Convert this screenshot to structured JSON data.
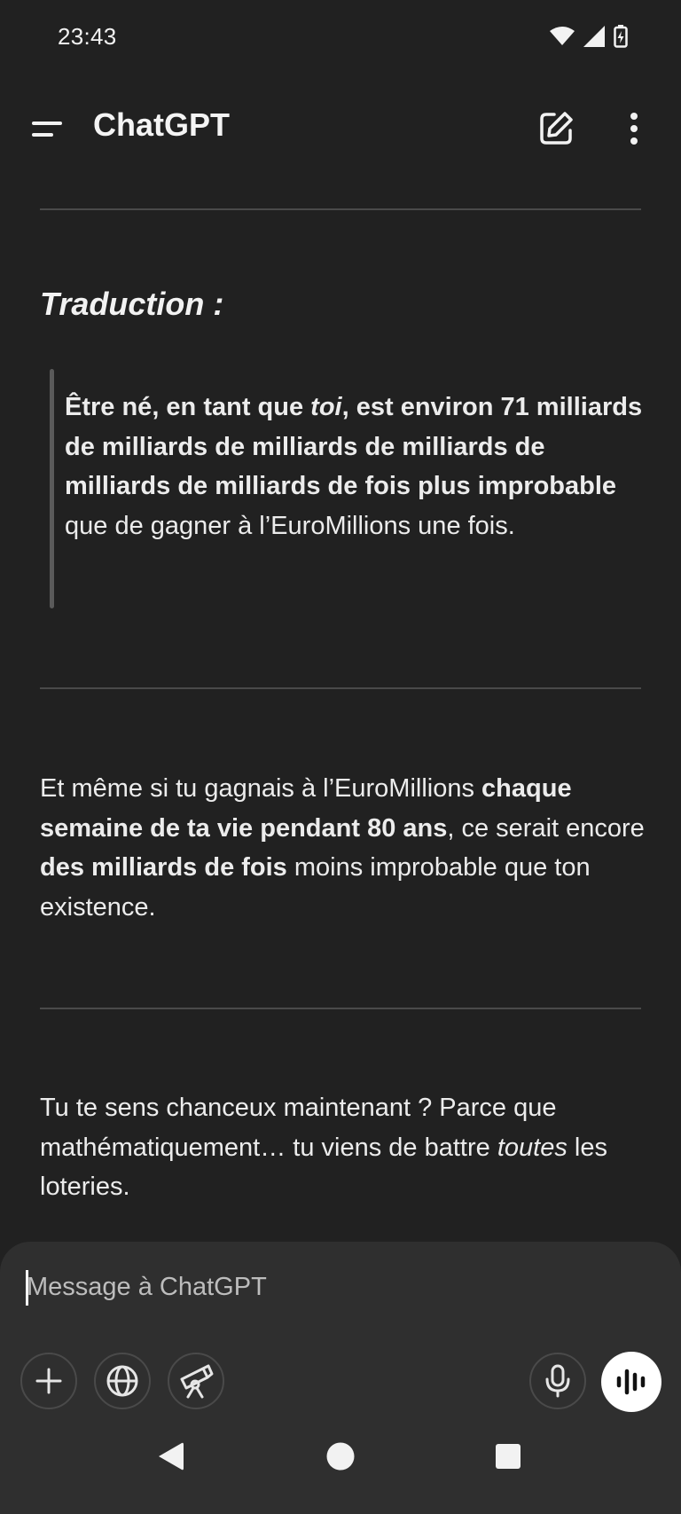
{
  "status_bar": {
    "time": "23:43"
  },
  "header": {
    "title": "ChatGPT"
  },
  "conversation": {
    "heading": "Traduction :",
    "quote": [
      {
        "text": "Être né, en tant que ",
        "style": "bold"
      },
      {
        "text": "toi",
        "style": "bold-italic"
      },
      {
        "text": ", est environ 71 milliards de milliards de milliards de milliards de milliards de milliards de fois plus improbable",
        "style": "bold"
      },
      {
        "text": " que de gagner à l’EuroMillions une fois.",
        "style": "normal"
      }
    ],
    "paragraph1": [
      {
        "text": "Et même si tu gagnais à l’EuroMillions ",
        "style": "normal"
      },
      {
        "text": "chaque semaine de ta vie pendant 80 ans",
        "style": "bold"
      },
      {
        "text": ", ce serait encore ",
        "style": "normal"
      },
      {
        "text": "des milliards de fois",
        "style": "bold"
      },
      {
        "text": " moins improbable que ton existence.",
        "style": "normal"
      }
    ],
    "paragraph2": [
      {
        "text": "Tu te sens chanceux maintenant ? Parce que mathématiquement… tu viens de battre ",
        "style": "normal"
      },
      {
        "text": "toutes",
        "style": "italic"
      },
      {
        "text": " les loteries.",
        "style": "normal"
      }
    ]
  },
  "composer": {
    "placeholder": "Message à ChatGPT",
    "value": ""
  },
  "icons": {
    "menu": "menu-icon",
    "new_chat": "edit-icon",
    "more": "more-vertical-icon",
    "add": "plus-icon",
    "search": "globe-icon",
    "tools": "telescope-icon",
    "mic": "microphone-icon",
    "voice": "voice-waveform-icon",
    "back": "back-triangle-icon",
    "home": "home-circle-icon",
    "recents": "recents-square-icon"
  },
  "colors": {
    "background": "#212121",
    "composer": "#2f2f2f",
    "text": "#ececec",
    "divider": "#4a4a4a"
  }
}
